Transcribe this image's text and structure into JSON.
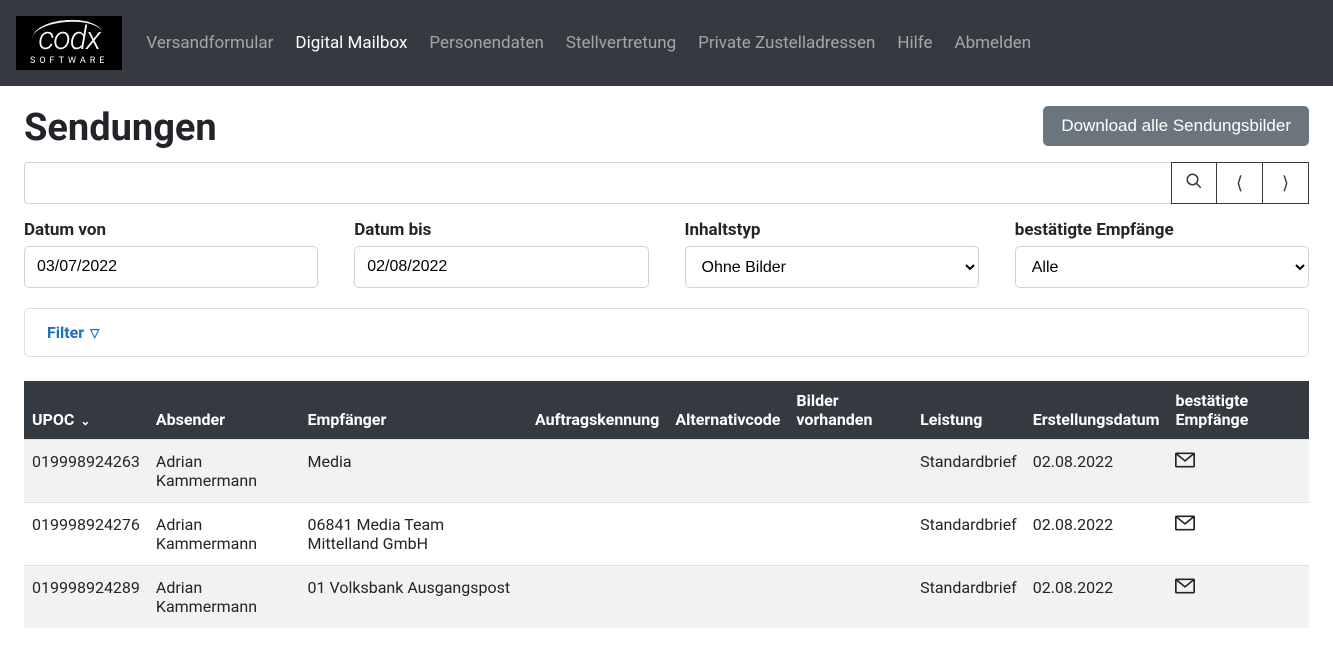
{
  "brand": {
    "main": "codx",
    "sub": "SOFTWARE"
  },
  "nav": {
    "items": [
      {
        "label": "Versandformular",
        "active": false
      },
      {
        "label": "Digital Mailbox",
        "active": true
      },
      {
        "label": "Personendaten",
        "active": false
      },
      {
        "label": "Stellvertretung",
        "active": false
      },
      {
        "label": "Private Zustelladressen",
        "active": false
      },
      {
        "label": "Hilfe",
        "active": false
      },
      {
        "label": "Abmelden",
        "active": false
      }
    ]
  },
  "page": {
    "title": "Sendungen",
    "download_all_label": "Download alle Sendungsbilder"
  },
  "filters": {
    "date_from_label": "Datum von",
    "date_from_value": "03/07/2022",
    "date_to_label": "Datum bis",
    "date_to_value": "02/08/2022",
    "content_type_label": "Inhaltstyp",
    "content_type_value": "Ohne Bilder",
    "confirmed_label": "bestätigte Empfänge",
    "confirmed_value": "Alle",
    "filter_toggle_label": "Filter"
  },
  "table": {
    "headers": {
      "upoc": "UPOC",
      "absender": "Absender",
      "empfaenger": "Empfänger",
      "auftragskennung": "Auftragskennung",
      "alternativcode": "Alternativcode",
      "bilder_vorhanden": "Bilder vorhanden",
      "leistung": "Leistung",
      "erstellungsdatum": "Erstellungsdatum",
      "bestaetigte": "bestätigte Empfänge"
    },
    "rows": [
      {
        "upoc": "019998924263",
        "absender": "Adrian Kammermann",
        "empfaenger": "Media",
        "auftragskennung": "",
        "alternativcode": "",
        "bilder_vorhanden": "",
        "leistung": "Standardbrief",
        "erstellungsdatum": "02.08.2022"
      },
      {
        "upoc": "019998924276",
        "absender": "Adrian Kammermann",
        "empfaenger": "06841 Media Team Mittelland GmbH",
        "auftragskennung": "",
        "alternativcode": "",
        "bilder_vorhanden": "",
        "leistung": "Standardbrief",
        "erstellungsdatum": "02.08.2022"
      },
      {
        "upoc": "019998924289",
        "absender": "Adrian Kammermann",
        "empfaenger": "01 Volksbank Ausgangspost",
        "auftragskennung": "",
        "alternativcode": "",
        "bilder_vorhanden": "",
        "leistung": "Standardbrief",
        "erstellungsdatum": "02.08.2022"
      }
    ]
  }
}
